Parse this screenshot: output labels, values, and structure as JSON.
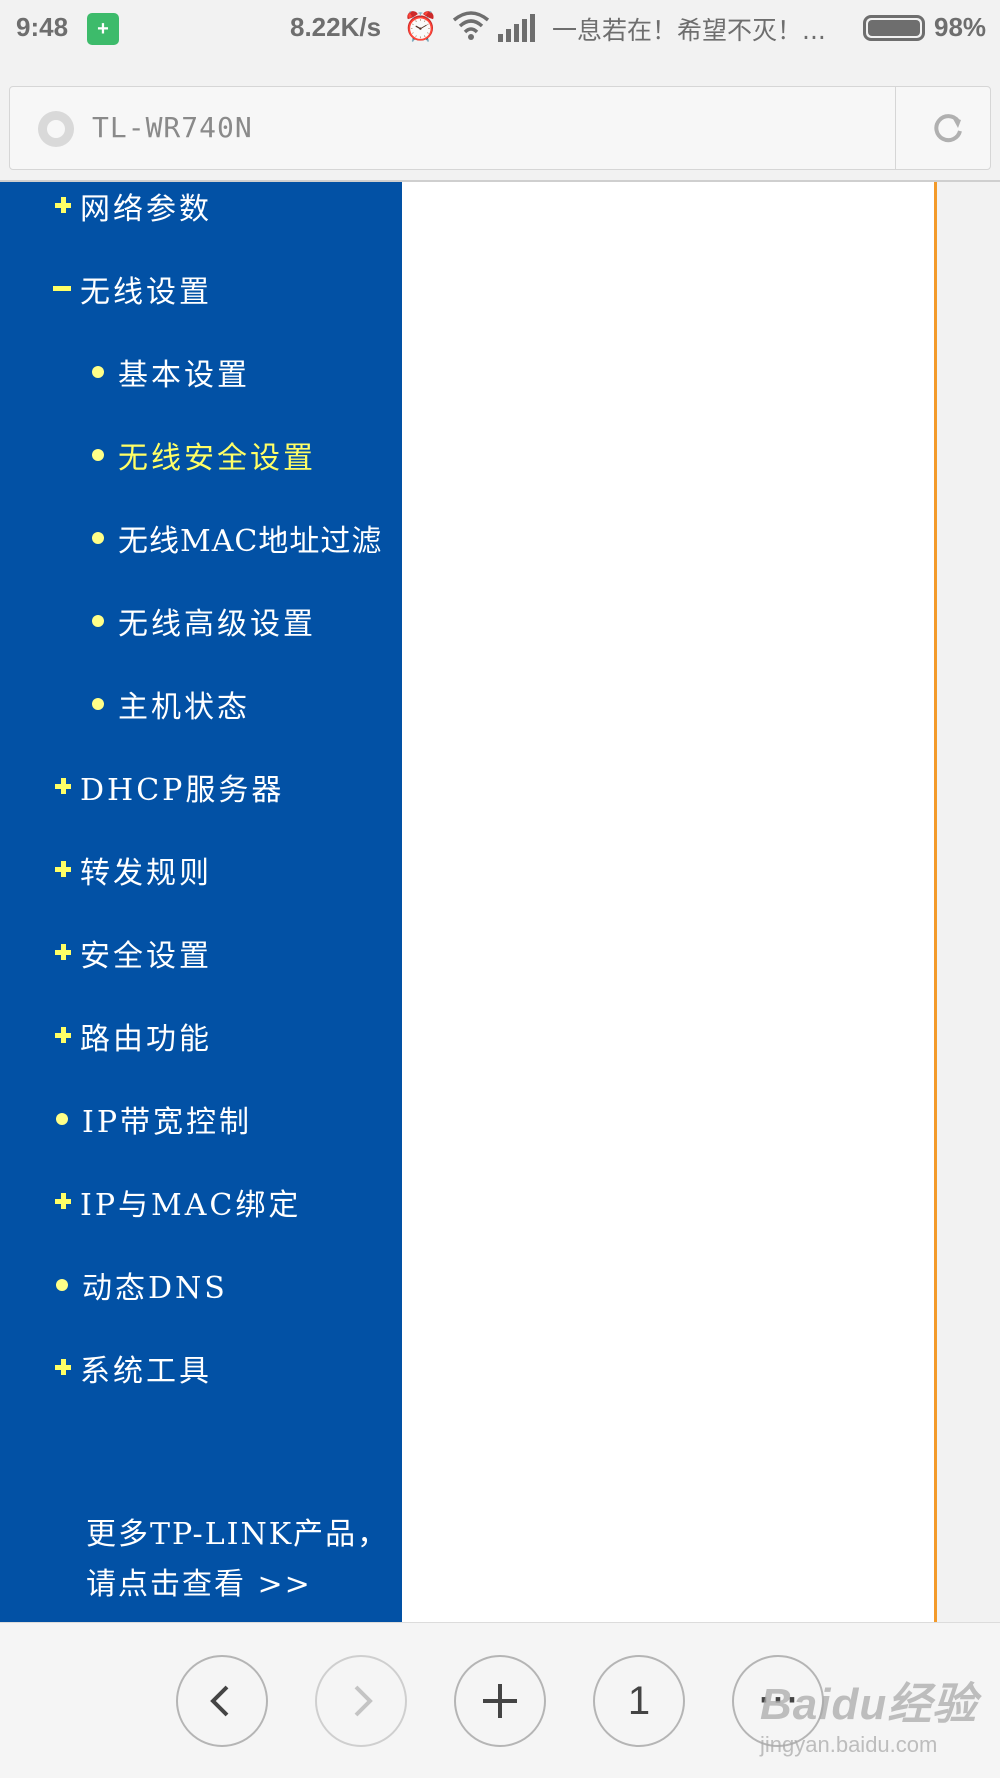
{
  "status_bar": {
    "time": "9:48",
    "speed": "8.22K/s",
    "notification": "一息若在！希望不灭！...",
    "battery": "98%",
    "battery_level": 0.98,
    "icons": [
      "shield-icon",
      "alarm-icon",
      "wifi-icon",
      "signal-icon",
      "battery-icon"
    ]
  },
  "address_bar": {
    "url": "TL-WR740N",
    "icons": [
      "site-icon",
      "refresh-icon"
    ]
  },
  "menu": {
    "items": [
      {
        "label": "网络参数",
        "marker": "plus",
        "level": 1
      },
      {
        "label": "无线设置",
        "marker": "minus",
        "level": 1
      },
      {
        "label": "基本设置",
        "marker": "dot",
        "level": 2
      },
      {
        "label": "无线安全设置",
        "marker": "dot",
        "level": 2,
        "active": true
      },
      {
        "label": "无线MAC地址过滤",
        "marker": "dot",
        "level": 2
      },
      {
        "label": "无线高级设置",
        "marker": "dot",
        "level": 2
      },
      {
        "label": "主机状态",
        "marker": "dot",
        "level": 2
      },
      {
        "label": "DHCP服务器",
        "marker": "plus",
        "level": 1
      },
      {
        "label": "转发规则",
        "marker": "plus",
        "level": 1
      },
      {
        "label": "安全设置",
        "marker": "plus",
        "level": 1
      },
      {
        "label": "路由功能",
        "marker": "plus",
        "level": 1
      },
      {
        "label": "IP带宽控制",
        "marker": "dot",
        "level": 1
      },
      {
        "label": "IP与MAC绑定",
        "marker": "plus",
        "level": 1
      },
      {
        "label": "动态DNS",
        "marker": "dot",
        "level": 1
      },
      {
        "label": "系统工具",
        "marker": "plus",
        "level": 1
      }
    ],
    "promo_line1": "更多TP-LINK产品，",
    "promo_line2": "请点击查看 >>",
    "colors": {
      "background": "#0251a5",
      "accent": "#ffff66",
      "text": "#ffffff"
    }
  },
  "toolbar": {
    "back": "‹",
    "forward": "›",
    "new_tab": "+",
    "tab_count": "1",
    "more": "···"
  },
  "watermark": {
    "brand": "Baidu经验",
    "url": "jingyan.baidu.com"
  }
}
